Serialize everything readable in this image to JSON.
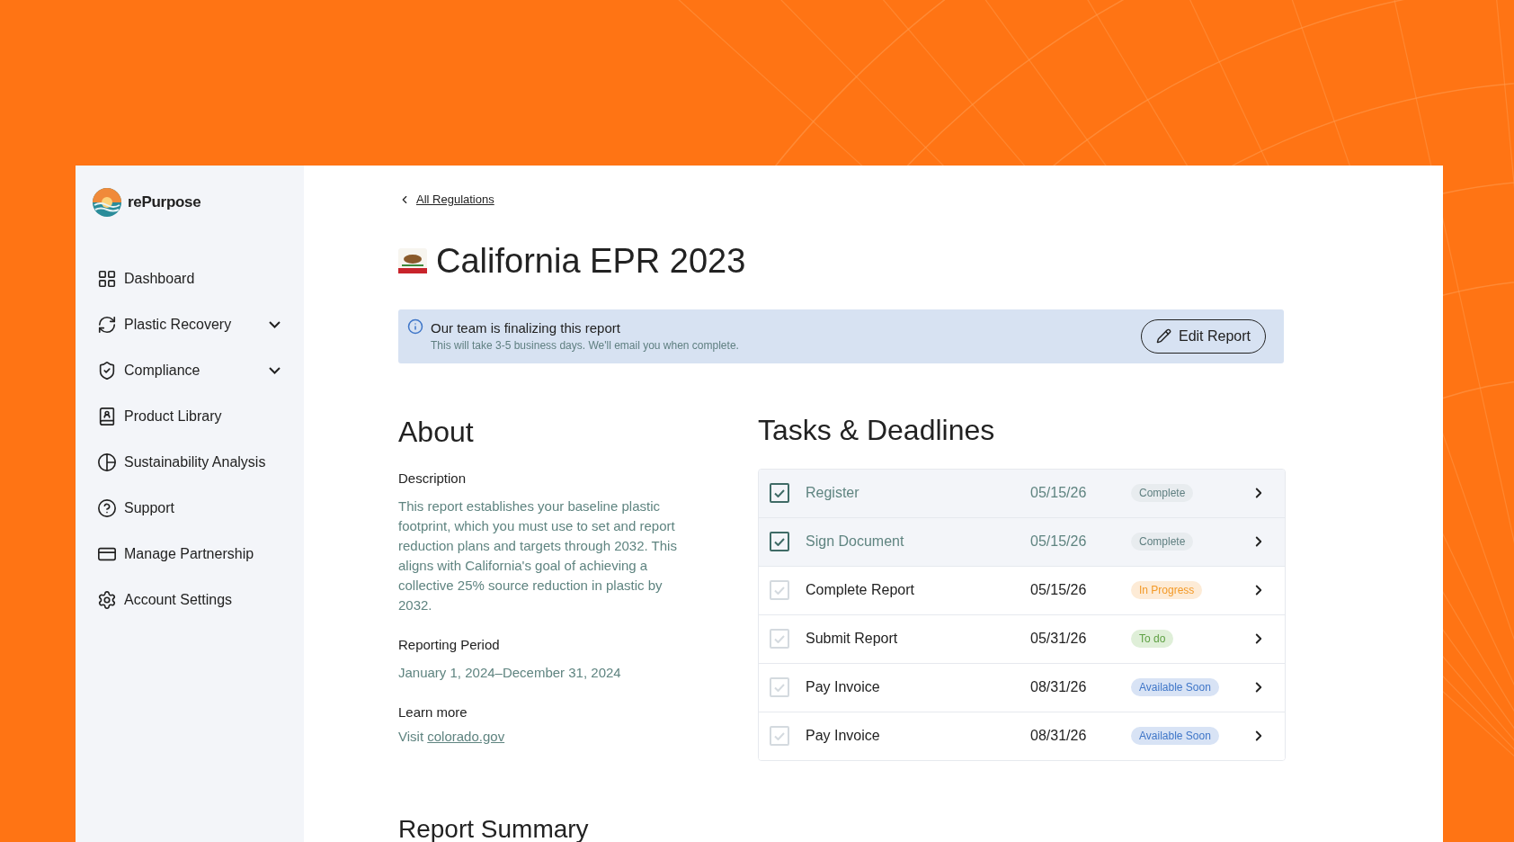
{
  "brand": {
    "name": "rePurpose"
  },
  "nav": [
    {
      "label": "Dashboard",
      "expandable": false
    },
    {
      "label": "Plastic Recovery",
      "expandable": true
    },
    {
      "label": "Compliance",
      "expandable": true
    },
    {
      "label": "Product Library",
      "expandable": false
    },
    {
      "label": "Sustainability Analysis",
      "expandable": false
    },
    {
      "label": "Support",
      "expandable": false
    },
    {
      "label": "Manage Partnership",
      "expandable": false
    },
    {
      "label": "Account Settings",
      "expandable": false
    }
  ],
  "back_link": "All Regulations",
  "title": "California EPR 2023",
  "banner": {
    "title": "Our team is finalizing this report",
    "subtitle": "This will take 3-5 business days. We'll email you when complete.",
    "button": "Edit Report"
  },
  "about": {
    "heading": "About",
    "fields": [
      {
        "label": "Description",
        "value": "This report establishes your baseline plastic footprint, which you must use to set and report reduction plans and targets through 2032. This aligns with California's goal of achieving a collective 25% source reduction in plastic by 2032."
      },
      {
        "label": "Reporting Period",
        "value": "January 1, 2024–December 31, 2024"
      }
    ],
    "learn_more": {
      "label": "Learn more",
      "prefix": "Visit",
      "link": "colorado.gov"
    }
  },
  "tasks": {
    "heading": "Tasks & Deadlines",
    "rows": [
      {
        "name": "Register",
        "date": "05/15/26",
        "status": "Complete",
        "kind": "complete",
        "checked": true
      },
      {
        "name": "Sign Document",
        "date": "05/15/26",
        "status": "Complete",
        "kind": "complete",
        "checked": true
      },
      {
        "name": "Complete Report",
        "date": "05/15/26",
        "status": "In Progress",
        "kind": "progress",
        "checked": false
      },
      {
        "name": "Submit Report",
        "date": "05/31/26",
        "status": "To do",
        "kind": "todo",
        "checked": false
      },
      {
        "name": "Pay Invoice",
        "date": "08/31/26",
        "status": "Available Soon",
        "kind": "soon",
        "checked": false
      },
      {
        "name": "Pay Invoice",
        "date": "08/31/26",
        "status": "Available Soon",
        "kind": "soon",
        "checked": false
      }
    ]
  },
  "summary_heading": "Report Summary"
}
